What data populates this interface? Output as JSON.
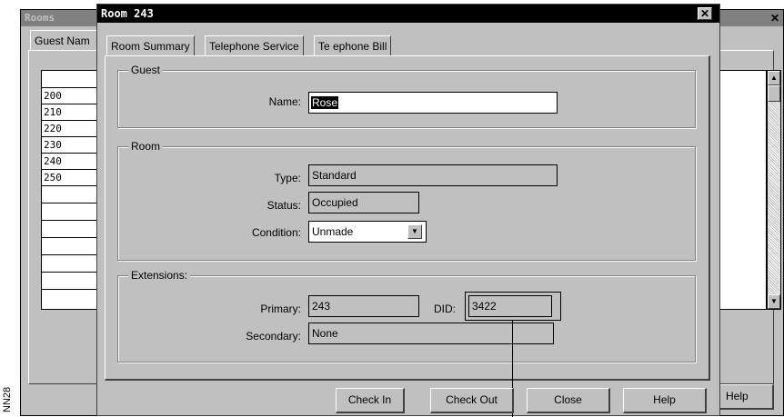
{
  "side_label": "NN28",
  "background_window": {
    "title": "Rooms",
    "tab_label": "Guest Nam",
    "rooms": [
      "200",
      "210",
      "220",
      "230",
      "240",
      "250",
      "",
      "",
      "",
      "",
      "",
      "",
      ""
    ],
    "help_label": "Help",
    "close_icon": "close-icon"
  },
  "dialog": {
    "title": "Room 243",
    "tabs": [
      "Room Summary",
      "Telephone Service",
      "Te ephone Bill"
    ],
    "guest": {
      "group_label": "Guest",
      "name_label": "Name:",
      "name_value": "Rose"
    },
    "room": {
      "group_label": "Room",
      "type_label": "Type:",
      "type_value": "Standard",
      "status_label": "Status:",
      "status_value": "Occupied",
      "condition_label": "Condition:",
      "condition_value": "Unmade"
    },
    "extensions": {
      "group_label": "Extensions:",
      "primary_label": "Primary:",
      "primary_value": "243",
      "did_label": "DID:",
      "did_value": "3422",
      "secondary_label": "Secondary:",
      "secondary_value": "None"
    },
    "buttons": {
      "check_in": "Check In",
      "check_out": "Check Out",
      "close": "Close",
      "help": "Help"
    }
  }
}
